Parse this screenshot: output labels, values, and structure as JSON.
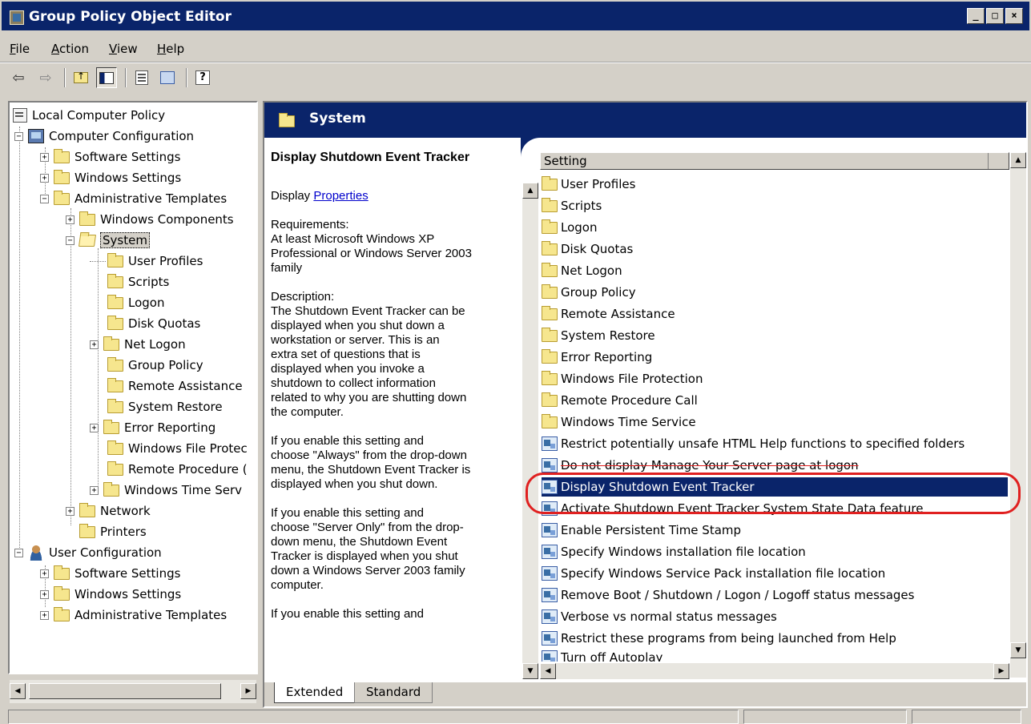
{
  "window": {
    "title": "Group Policy Object Editor",
    "buttons": {
      "minimize": "_",
      "maximize": "□",
      "close": "×"
    }
  },
  "menu": [
    "File",
    "Action",
    "View",
    "Help"
  ],
  "toolbar": [
    "back-icon",
    "forward-icon",
    "up-folder-icon",
    "show-hide-tree-icon",
    "properties-icon",
    "export-list-icon",
    "help-icon"
  ],
  "tree": {
    "root": "Local Computer Policy",
    "computer_config": "Computer Configuration",
    "cc_software": "Software Settings",
    "cc_windows": "Windows Settings",
    "cc_admin": "Administrative Templates",
    "cc_wincomp": "Windows Components",
    "system": "System",
    "system_children": [
      "User Profiles",
      "Scripts",
      "Logon",
      "Disk Quotas",
      "Net Logon",
      "Group Policy",
      "Remote Assistance",
      "System Restore",
      "Error Reporting",
      "Windows File Protec",
      "Remote Procedure (",
      "Windows Time Serv"
    ],
    "network": "Network",
    "printers": "Printers",
    "user_config": "User Configuration",
    "uc_software": "Software Settings",
    "uc_windows": "Windows Settings",
    "uc_admin": "Administrative Templates"
  },
  "details": {
    "header_title": "System",
    "setting_title": "Display Shutdown Event Tracker",
    "display_prefix": "Display",
    "properties_link": "Properties",
    "requirements": "Requirements:\nAt least Microsoft Windows XP\nProfessional or Windows Server 2003\nfamily",
    "description": "Description:\nThe Shutdown Event Tracker can be\ndisplayed when you shut down a\nworkstation or server.  This is an\nextra set of questions that is\ndisplayed when you invoke a\nshutdown to collect information\nrelated to why you are shutting down\nthe computer.",
    "para_always": "If you enable this setting and\nchoose \"Always\" from the drop-down\nmenu, the Shutdown Event Tracker is\ndisplayed when you shut down.",
    "para_server_only": "If you enable this setting and\nchoose \"Server Only\" from the drop-\ndown menu, the Shutdown Event\nTracker is displayed when you shut\ndown a Windows Server 2003 family\ncomputer.",
    "para_cut": "If you enable this setting and"
  },
  "list": {
    "column_header": "Setting",
    "folders": [
      "User Profiles",
      "Scripts",
      "Logon",
      "Disk Quotas",
      "Net Logon",
      "Group Policy",
      "Remote Assistance",
      "System Restore",
      "Error Reporting",
      "Windows File Protection",
      "Remote Procedure Call",
      "Windows Time Service"
    ],
    "settings": [
      "Restrict potentially unsafe HTML Help functions to specified folders",
      "Do not display Manage Your Server page at logon",
      "Display Shutdown Event Tracker",
      "Activate Shutdown Event Tracker System State Data feature",
      "Enable Persistent Time Stamp",
      "Specify Windows installation file location",
      "Specify Windows Service Pack installation file location",
      "Remove Boot / Shutdown / Logon / Logoff status messages",
      "Verbose vs normal status messages",
      "Restrict these programs from being launched from Help",
      "Turn off Autoplay"
    ],
    "selected_index": 2
  },
  "tabs": [
    "Extended",
    "Standard"
  ],
  "colors": {
    "title_bar": "#0a246a",
    "selection": "#0a246a",
    "highlight_ring": "#e02020",
    "link": "#0000cc"
  }
}
